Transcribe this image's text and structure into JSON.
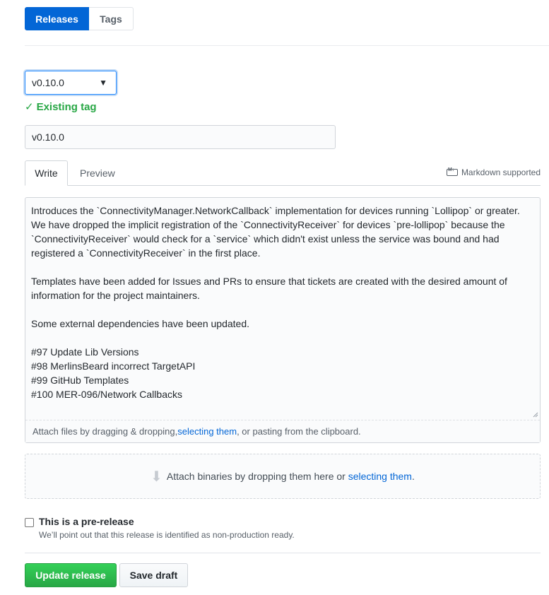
{
  "tabs": {
    "releases": "Releases",
    "tags": "Tags"
  },
  "tag": {
    "selected": "v0.10.0",
    "status": "Existing tag"
  },
  "release_title": {
    "value": "v0.10.0"
  },
  "editor": {
    "write_tab": "Write",
    "preview_tab": "Preview",
    "markdown_note": "Markdown supported",
    "body": "Introduces the `ConnectivityManager.NetworkCallback` implementation for devices running `Lollipop` or greater. We have dropped the implicit registration of the `ConnectivityReceiver` for devices `pre-lollipop` because the `ConnectivityReceiver` would check for a `service` which didn't exist unless the service was bound and had registered a `ConnectivityReceiver` in the first place.\n\nTemplates have been added for Issues and PRs to ensure that tickets are created with the desired amount of information for the project maintainers.\n\nSome external dependencies have been updated.\n\n#97 Update Lib Versions\n#98 MerlinsBeard incorrect TargetAPI\n#99 GitHub Templates\n#100 MER-096/Network Callbacks",
    "attach_prefix": "Attach files by dragging & dropping, ",
    "attach_link": "selecting them",
    "attach_suffix": ", or pasting from the clipboard."
  },
  "binaries": {
    "prefix": "Attach binaries by dropping them here or ",
    "link": "selecting them",
    "suffix": "."
  },
  "prerelease": {
    "label": "This is a pre-release",
    "note": "We’ll point out that this release is identified as non-production ready."
  },
  "actions": {
    "update": "Update release",
    "draft": "Save draft"
  },
  "colors": {
    "primary": "#0366d6",
    "success": "#28a745",
    "muted": "#586069"
  }
}
